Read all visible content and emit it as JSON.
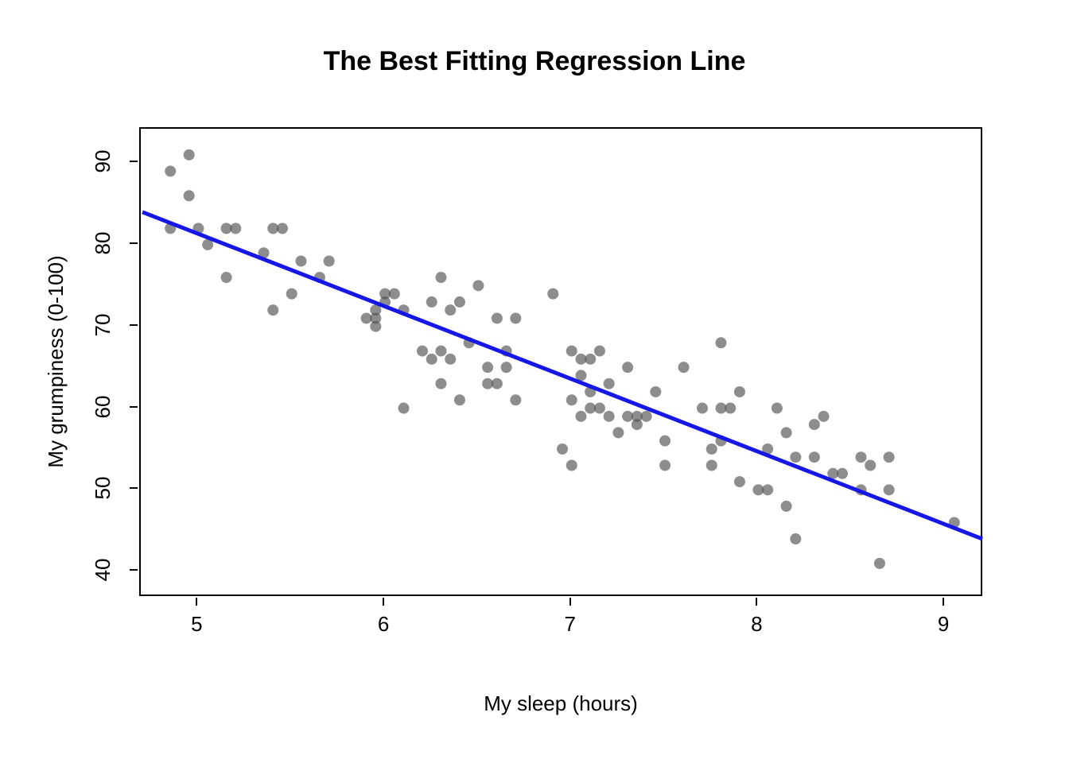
{
  "chart_data": {
    "type": "scatter",
    "title": "The Best Fitting Regression Line",
    "xlabel": "My sleep (hours)",
    "ylabel": "My grumpiness (0-100)",
    "xlim": [
      4.7,
      9.2
    ],
    "ylim": [
      37,
      94
    ],
    "xticks": [
      5,
      6,
      7,
      8,
      9
    ],
    "yticks": [
      40,
      50,
      60,
      70,
      80,
      90
    ],
    "series": [
      {
        "name": "observations",
        "kind": "points",
        "color": "rgba(80,80,80,0.65)",
        "x": [
          4.85,
          4.85,
          4.95,
          4.95,
          5.0,
          5.05,
          5.15,
          5.15,
          5.2,
          5.35,
          5.4,
          5.4,
          5.45,
          5.5,
          5.55,
          5.65,
          5.7,
          5.9,
          5.95,
          5.95,
          5.95,
          6.0,
          6.0,
          6.05,
          6.1,
          6.1,
          6.2,
          6.25,
          6.25,
          6.3,
          6.3,
          6.3,
          6.35,
          6.35,
          6.4,
          6.4,
          6.45,
          6.5,
          6.55,
          6.55,
          6.6,
          6.6,
          6.65,
          6.65,
          6.7,
          6.7,
          6.9,
          6.95,
          7.0,
          7.0,
          7.0,
          7.05,
          7.05,
          7.05,
          7.1,
          7.1,
          7.1,
          7.15,
          7.15,
          7.2,
          7.2,
          7.25,
          7.3,
          7.3,
          7.35,
          7.35,
          7.4,
          7.45,
          7.5,
          7.5,
          7.6,
          7.7,
          7.75,
          7.75,
          7.8,
          7.8,
          7.8,
          7.85,
          7.9,
          7.9,
          8.0,
          8.05,
          8.05,
          8.1,
          8.15,
          8.15,
          8.2,
          8.2,
          8.3,
          8.3,
          8.35,
          8.4,
          8.45,
          8.55,
          8.55,
          8.6,
          8.65,
          8.7,
          8.7,
          9.05
        ],
        "y": [
          89,
          82,
          91,
          86,
          82,
          80,
          82,
          76,
          82,
          79,
          72,
          82,
          82,
          74,
          78,
          76,
          78,
          71,
          72,
          71,
          70,
          73,
          74,
          74,
          72,
          60,
          67,
          66,
          73,
          67,
          76,
          63,
          66,
          72,
          61,
          73,
          68,
          75,
          63,
          65,
          71,
          63,
          65,
          67,
          61,
          71,
          74,
          55,
          67,
          61,
          53,
          64,
          59,
          66,
          62,
          60,
          66,
          67,
          60,
          59,
          63,
          57,
          59,
          65,
          58,
          59,
          59,
          62,
          53,
          56,
          65,
          60,
          53,
          55,
          60,
          68,
          56,
          60,
          62,
          51,
          50,
          55,
          50,
          60,
          48,
          57,
          54,
          44,
          58,
          54,
          59,
          52,
          52,
          50,
          54,
          53,
          41,
          50,
          54,
          46
        ]
      },
      {
        "name": "regression-line",
        "kind": "line",
        "color": "#1616e6",
        "x": [
          4.7,
          9.2
        ],
        "y": [
          84,
          44
        ]
      }
    ]
  }
}
